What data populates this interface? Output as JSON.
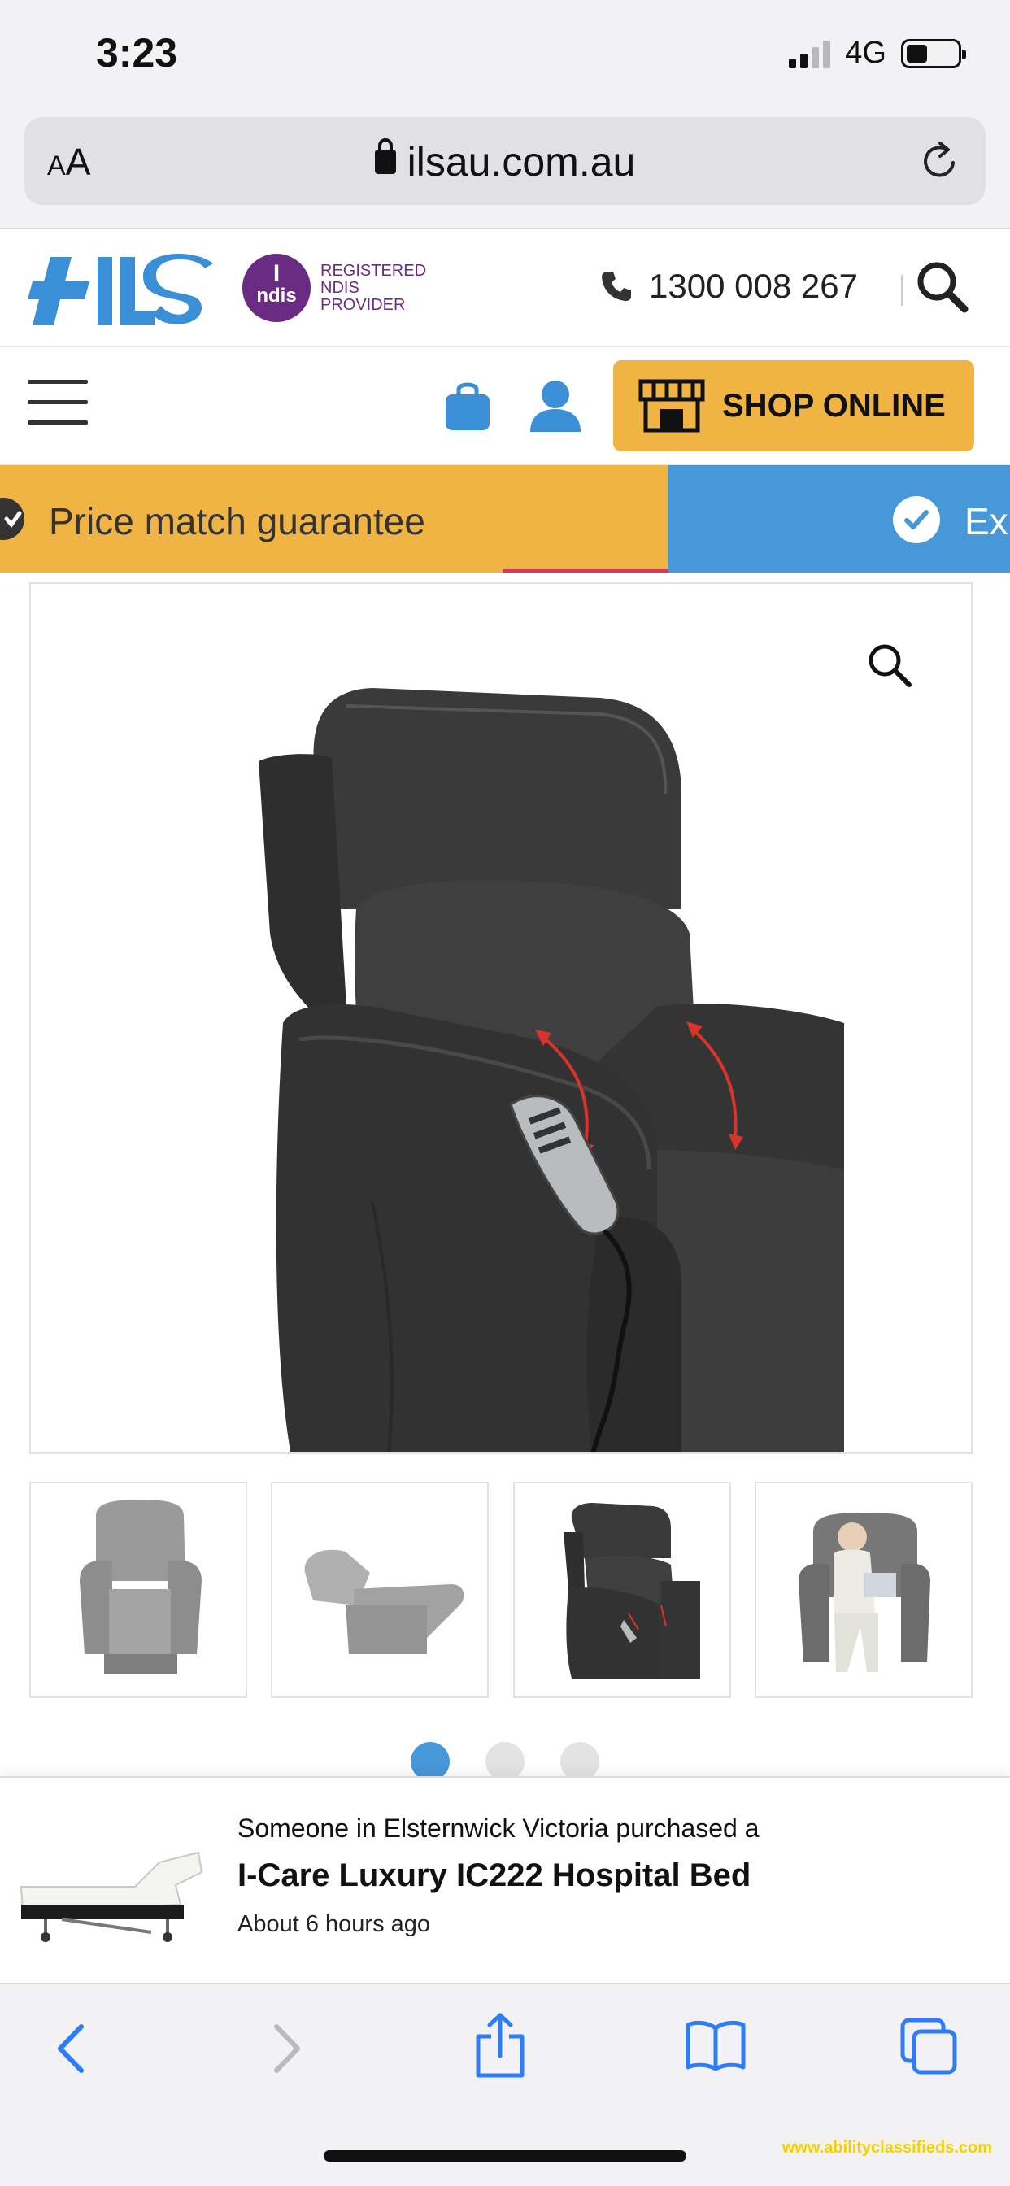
{
  "status_bar": {
    "time": "3:23",
    "network": "4G"
  },
  "browser": {
    "aa_small": "A",
    "aa_large": "A",
    "url": "ilsau.com.au"
  },
  "header": {
    "logo_text": "ILS",
    "ndis_badge_top": "I",
    "ndis_badge_bottom": "ndis",
    "ndis_text": [
      "REGISTERED",
      "NDIS",
      "PROVIDER"
    ],
    "phone": "1300 008 267"
  },
  "nav": {
    "shop_label": "SHOP ONLINE"
  },
  "promo": {
    "left_text": "Price match guarantee",
    "right_text": "Ex"
  },
  "carousel": {
    "dot_count": 3,
    "active_index": 0
  },
  "notification": {
    "line1": "Someone in Elsternwick Victoria purchased a",
    "product": "I-Care Luxury IC222 Hospital Bed",
    "time": "About 6 hours ago"
  },
  "watermark": "www.abilityclassifieds.com",
  "colors": {
    "accent_yellow": "#f0b445",
    "accent_blue": "#4798d9",
    "ndis_purple": "#6a2c82",
    "chair_leather": "#3b3a3a"
  }
}
